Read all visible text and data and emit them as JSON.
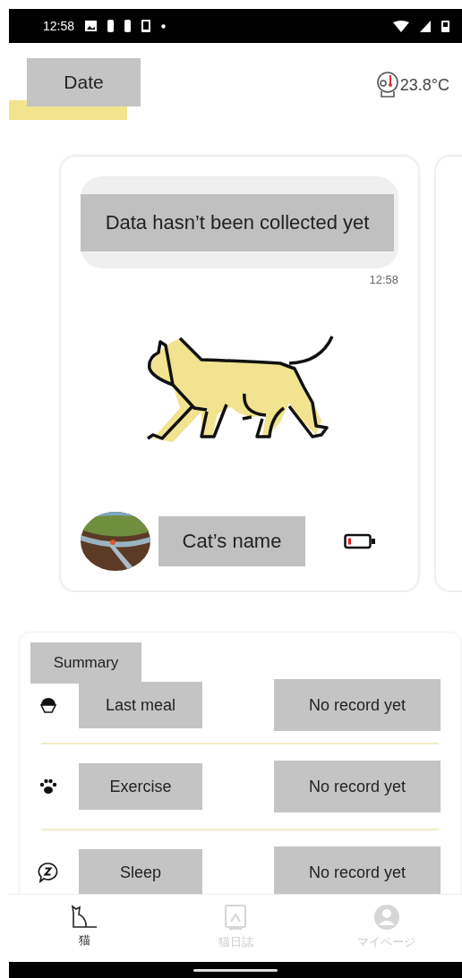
{
  "status_bar": {
    "time": "12:58"
  },
  "header": {
    "date_label": "Date",
    "temperature": "23.8°C"
  },
  "cat_card": {
    "message": "Data hasn’t been collected yet",
    "time": "12:58",
    "cat_name": "Cat’s name"
  },
  "summary": {
    "title": "Summary",
    "rows": [
      {
        "kind": "meal",
        "label": "Last meal",
        "value": "No record yet"
      },
      {
        "kind": "exercise",
        "label": "Exercise",
        "value": "No record yet"
      },
      {
        "kind": "sleep",
        "label": "Sleep",
        "value": "No record yet"
      }
    ]
  },
  "tabs": [
    {
      "kind": "cat",
      "label": "猫",
      "selected": true
    },
    {
      "kind": "diary",
      "label": "猫日誌",
      "selected": false
    },
    {
      "kind": "mypage",
      "label": "マイページ",
      "selected": false
    }
  ]
}
